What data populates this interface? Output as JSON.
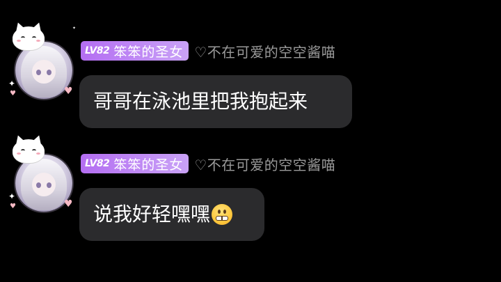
{
  "messages": [
    {
      "badge_level": "LV82",
      "badge_title": "笨笨的圣女",
      "username": "♡不在可爱的空空酱喵",
      "text": "哥哥在泳池里把我抱起来"
    },
    {
      "badge_level": "LV82",
      "badge_title": "笨笨的圣女",
      "username": "♡不在可爱的空空酱喵",
      "text": "说我好轻嘿嘿",
      "emoji": "grimacing-face-emoji"
    }
  ],
  "colors": {
    "background": "#000000",
    "bubble": "#2b2b2d",
    "badge_start": "#b46ef2",
    "badge_end": "#c9a2f6",
    "username": "#9a9a9a",
    "message_text": "#ffffff"
  }
}
